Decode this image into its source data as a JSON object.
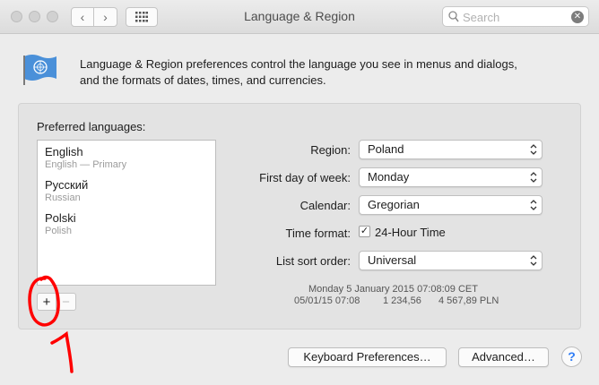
{
  "window": {
    "title": "Language & Region"
  },
  "toolbar": {
    "back_label": "‹",
    "forward_label": "›",
    "search_placeholder": "Search",
    "search_value": ""
  },
  "header": {
    "icon": "united-nations-flag-icon",
    "description_line1": "Language & Region preferences control the language you see in menus and dialogs,",
    "description_line2": "and the formats of dates, times, and currencies."
  },
  "languages": {
    "label": "Preferred languages:",
    "items": [
      {
        "name": "English",
        "sub": "English — Primary"
      },
      {
        "name": "Русский",
        "sub": "Russian"
      },
      {
        "name": "Polski",
        "sub": "Polish"
      }
    ],
    "add_label": "+",
    "remove_label": "−"
  },
  "settings": {
    "region_label": "Region:",
    "region_value": "Poland",
    "first_day_label": "First day of week:",
    "first_day_value": "Monday",
    "calendar_label": "Calendar:",
    "calendar_value": "Gregorian",
    "time_format_label": "Time format:",
    "time_format_checkbox": "24-Hour Time",
    "time_format_checked": true,
    "sort_label": "List sort order:",
    "sort_value": "Universal"
  },
  "sample": {
    "date_time": "Monday 5 January 2015 07:08:09 CET",
    "short_date": "05/01/15 07:08",
    "number": "1 234,56",
    "currency": "4 567,89 PLN"
  },
  "buttons": {
    "keyboard": "Keyboard Preferences…",
    "advanced": "Advanced…",
    "help": "?"
  },
  "annotation": {
    "number": "1",
    "color": "#ff0000"
  },
  "colors": {
    "accent": "#2f7df6",
    "flag_blue": "#4a90d9"
  }
}
